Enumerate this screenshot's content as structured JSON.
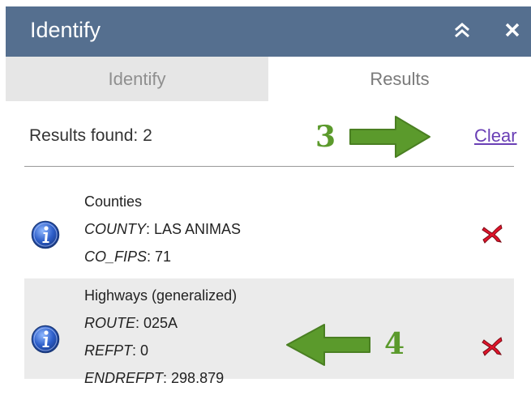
{
  "window": {
    "title": "Identify"
  },
  "tabs": {
    "identify": "Identify",
    "results": "Results",
    "active": "Results"
  },
  "summary": {
    "label": "Results found: 2",
    "clear": "Clear"
  },
  "annotations": {
    "clear_marker": "3",
    "result_marker": "4"
  },
  "results": [
    {
      "layer": "Counties",
      "fields": [
        {
          "key": "COUNTY",
          "sep": ": ",
          "value": "LAS ANIMAS"
        },
        {
          "key": "CO_FIPS",
          "sep": ": ",
          "value": "71"
        }
      ]
    },
    {
      "layer": "Highways (generalized)",
      "fields": [
        {
          "key": "ROUTE",
          "sep": ": ",
          "value": "025A"
        },
        {
          "key": "REFPT",
          "sep": ": ",
          "value": "0"
        },
        {
          "key": "ENDREFPT",
          "sep": ": ",
          "value": "298.879"
        }
      ]
    }
  ],
  "colors": {
    "titlebar": "#556f8f",
    "annotation_green": "#5b9a2c",
    "remove_red": "#e0142b",
    "link": "#6a3fb5"
  },
  "icons": {
    "collapse": "double-chevron-up-icon",
    "close": "close-icon",
    "info": "info-icon",
    "remove": "remove-x-icon",
    "arrow": "green-arrow"
  }
}
